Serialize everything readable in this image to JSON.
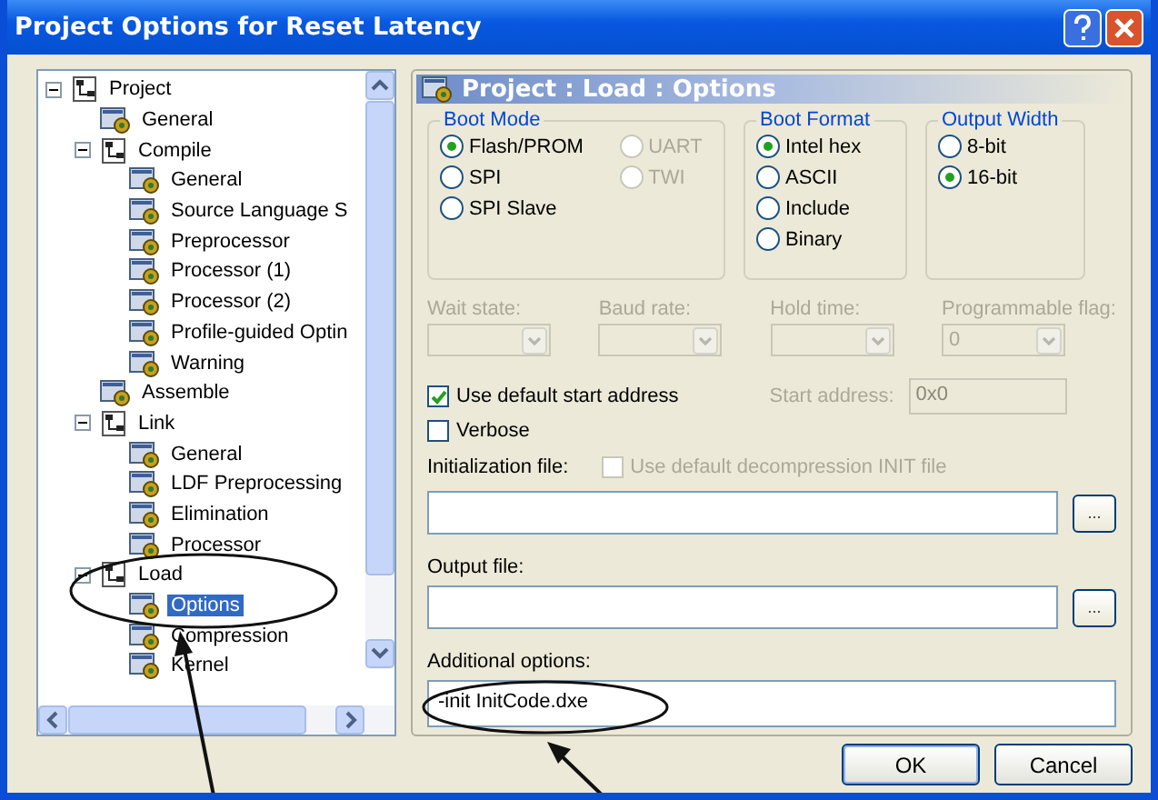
{
  "window": {
    "title": "Project Options for Reset Latency"
  },
  "tree": [
    {
      "label": "Project",
      "expanded": true,
      "selected": false,
      "children": [
        {
          "label": "General",
          "selected": false
        },
        {
          "label": "Compile",
          "expanded": true,
          "selected": false,
          "children": [
            {
              "label": "General",
              "selected": false
            },
            {
              "label": "Source Language S",
              "selected": false
            },
            {
              "label": "Preprocessor",
              "selected": false
            },
            {
              "label": "Processor (1)",
              "selected": false
            },
            {
              "label": "Processor (2)",
              "selected": false
            },
            {
              "label": "Profile-guided Optin",
              "selected": false
            },
            {
              "label": "Warning",
              "selected": false
            }
          ]
        },
        {
          "label": "Assemble",
          "selected": false
        },
        {
          "label": "Link",
          "expanded": true,
          "selected": false,
          "children": [
            {
              "label": "General",
              "selected": false
            },
            {
              "label": "LDF Preprocessing",
              "selected": false
            },
            {
              "label": "Elimination",
              "selected": false
            },
            {
              "label": "Processor",
              "selected": false
            }
          ]
        },
        {
          "label": "Load",
          "expanded": true,
          "selected": false,
          "children": [
            {
              "label": "Options",
              "selected": true
            },
            {
              "label": "Compression",
              "selected": false
            },
            {
              "label": "Kernel",
              "selected": false
            }
          ]
        }
      ]
    }
  ],
  "panel": {
    "title": "Project : Load : Options",
    "groups": [
      {
        "title": "Boot Mode",
        "options": [
          {
            "label": "Flash/PROM",
            "selected": true,
            "disabled": false
          },
          {
            "label": "SPI",
            "selected": false,
            "disabled": false
          },
          {
            "label": "SPI Slave",
            "selected": false,
            "disabled": false
          },
          {
            "label": "UART",
            "selected": false,
            "disabled": true
          },
          {
            "label": "TWI",
            "selected": false,
            "disabled": true
          }
        ]
      },
      {
        "title": "Boot Format",
        "options": [
          {
            "label": "Intel hex",
            "selected": true,
            "disabled": false
          },
          {
            "label": "ASCII",
            "selected": false,
            "disabled": false
          },
          {
            "label": "Include",
            "selected": false,
            "disabled": false
          },
          {
            "label": "Binary",
            "selected": false,
            "disabled": false
          }
        ]
      },
      {
        "title": "Output Width",
        "options": [
          {
            "label": "8-bit",
            "selected": false,
            "disabled": false
          },
          {
            "label": "16-bit",
            "selected": true,
            "disabled": false
          }
        ]
      }
    ],
    "dropdowns": [
      {
        "label": "Wait state:",
        "disabled": true
      },
      {
        "label": "Baud rate:",
        "disabled": true
      },
      {
        "label": "Hold time:",
        "disabled": true
      },
      {
        "label": "Programmable flag:",
        "value": "0",
        "disabled": true
      }
    ],
    "default_start": {
      "label": "Use default start address",
      "checked": true
    },
    "start_address": {
      "label": "Start address:",
      "value": "0x0",
      "disabled": true
    },
    "verbose": {
      "label": "Verbose",
      "checked": false
    },
    "init_file": {
      "label": "Initialization file:",
      "browse": "...",
      "default_init": {
        "label": "Use default decompression INIT file",
        "checked": false,
        "disabled": true
      }
    },
    "output_file": {
      "label": "Output file:",
      "browse": "..."
    },
    "additional_options": {
      "label": "Additional options:",
      "value": "-init InitCode.dxe"
    }
  },
  "buttons": [
    "OK",
    "Cancel"
  ]
}
